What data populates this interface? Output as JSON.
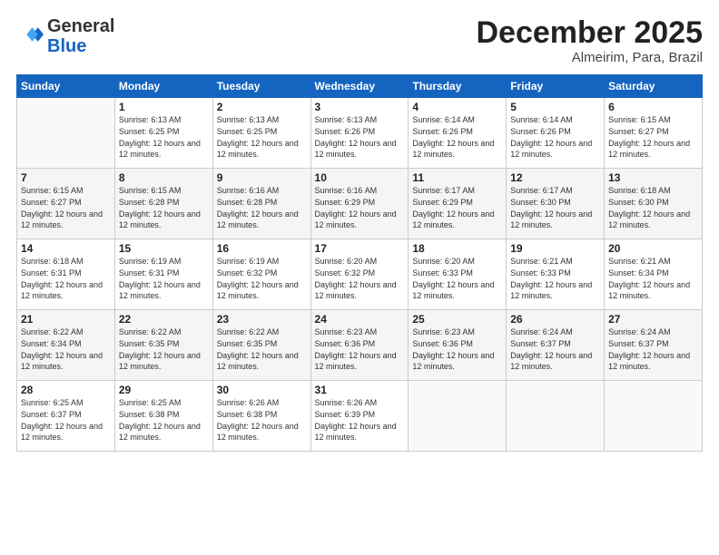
{
  "header": {
    "logo_general": "General",
    "logo_blue": "Blue",
    "month_title": "December 2025",
    "location": "Almeirim, Para, Brazil"
  },
  "days_of_week": [
    "Sunday",
    "Monday",
    "Tuesday",
    "Wednesday",
    "Thursday",
    "Friday",
    "Saturday"
  ],
  "weeks": [
    [
      {
        "day": "",
        "empty": true
      },
      {
        "day": "1",
        "sunrise": "6:13 AM",
        "sunset": "6:25 PM",
        "daylight": "12 hours and 12 minutes."
      },
      {
        "day": "2",
        "sunrise": "6:13 AM",
        "sunset": "6:25 PM",
        "daylight": "12 hours and 12 minutes."
      },
      {
        "day": "3",
        "sunrise": "6:13 AM",
        "sunset": "6:26 PM",
        "daylight": "12 hours and 12 minutes."
      },
      {
        "day": "4",
        "sunrise": "6:14 AM",
        "sunset": "6:26 PM",
        "daylight": "12 hours and 12 minutes."
      },
      {
        "day": "5",
        "sunrise": "6:14 AM",
        "sunset": "6:26 PM",
        "daylight": "12 hours and 12 minutes."
      },
      {
        "day": "6",
        "sunrise": "6:15 AM",
        "sunset": "6:27 PM",
        "daylight": "12 hours and 12 minutes."
      }
    ],
    [
      {
        "day": "7",
        "sunrise": "6:15 AM",
        "sunset": "6:27 PM",
        "daylight": "12 hours and 12 minutes."
      },
      {
        "day": "8",
        "sunrise": "6:15 AM",
        "sunset": "6:28 PM",
        "daylight": "12 hours and 12 minutes."
      },
      {
        "day": "9",
        "sunrise": "6:16 AM",
        "sunset": "6:28 PM",
        "daylight": "12 hours and 12 minutes."
      },
      {
        "day": "10",
        "sunrise": "6:16 AM",
        "sunset": "6:29 PM",
        "daylight": "12 hours and 12 minutes."
      },
      {
        "day": "11",
        "sunrise": "6:17 AM",
        "sunset": "6:29 PM",
        "daylight": "12 hours and 12 minutes."
      },
      {
        "day": "12",
        "sunrise": "6:17 AM",
        "sunset": "6:30 PM",
        "daylight": "12 hours and 12 minutes."
      },
      {
        "day": "13",
        "sunrise": "6:18 AM",
        "sunset": "6:30 PM",
        "daylight": "12 hours and 12 minutes."
      }
    ],
    [
      {
        "day": "14",
        "sunrise": "6:18 AM",
        "sunset": "6:31 PM",
        "daylight": "12 hours and 12 minutes."
      },
      {
        "day": "15",
        "sunrise": "6:19 AM",
        "sunset": "6:31 PM",
        "daylight": "12 hours and 12 minutes."
      },
      {
        "day": "16",
        "sunrise": "6:19 AM",
        "sunset": "6:32 PM",
        "daylight": "12 hours and 12 minutes."
      },
      {
        "day": "17",
        "sunrise": "6:20 AM",
        "sunset": "6:32 PM",
        "daylight": "12 hours and 12 minutes."
      },
      {
        "day": "18",
        "sunrise": "6:20 AM",
        "sunset": "6:33 PM",
        "daylight": "12 hours and 12 minutes."
      },
      {
        "day": "19",
        "sunrise": "6:21 AM",
        "sunset": "6:33 PM",
        "daylight": "12 hours and 12 minutes."
      },
      {
        "day": "20",
        "sunrise": "6:21 AM",
        "sunset": "6:34 PM",
        "daylight": "12 hours and 12 minutes."
      }
    ],
    [
      {
        "day": "21",
        "sunrise": "6:22 AM",
        "sunset": "6:34 PM",
        "daylight": "12 hours and 12 minutes."
      },
      {
        "day": "22",
        "sunrise": "6:22 AM",
        "sunset": "6:35 PM",
        "daylight": "12 hours and 12 minutes."
      },
      {
        "day": "23",
        "sunrise": "6:22 AM",
        "sunset": "6:35 PM",
        "daylight": "12 hours and 12 minutes."
      },
      {
        "day": "24",
        "sunrise": "6:23 AM",
        "sunset": "6:36 PM",
        "daylight": "12 hours and 12 minutes."
      },
      {
        "day": "25",
        "sunrise": "6:23 AM",
        "sunset": "6:36 PM",
        "daylight": "12 hours and 12 minutes."
      },
      {
        "day": "26",
        "sunrise": "6:24 AM",
        "sunset": "6:37 PM",
        "daylight": "12 hours and 12 minutes."
      },
      {
        "day": "27",
        "sunrise": "6:24 AM",
        "sunset": "6:37 PM",
        "daylight": "12 hours and 12 minutes."
      }
    ],
    [
      {
        "day": "28",
        "sunrise": "6:25 AM",
        "sunset": "6:37 PM",
        "daylight": "12 hours and 12 minutes."
      },
      {
        "day": "29",
        "sunrise": "6:25 AM",
        "sunset": "6:38 PM",
        "daylight": "12 hours and 12 minutes."
      },
      {
        "day": "30",
        "sunrise": "6:26 AM",
        "sunset": "6:38 PM",
        "daylight": "12 hours and 12 minutes."
      },
      {
        "day": "31",
        "sunrise": "6:26 AM",
        "sunset": "6:39 PM",
        "daylight": "12 hours and 12 minutes."
      },
      {
        "day": "",
        "empty": true
      },
      {
        "day": "",
        "empty": true
      },
      {
        "day": "",
        "empty": true
      }
    ]
  ]
}
